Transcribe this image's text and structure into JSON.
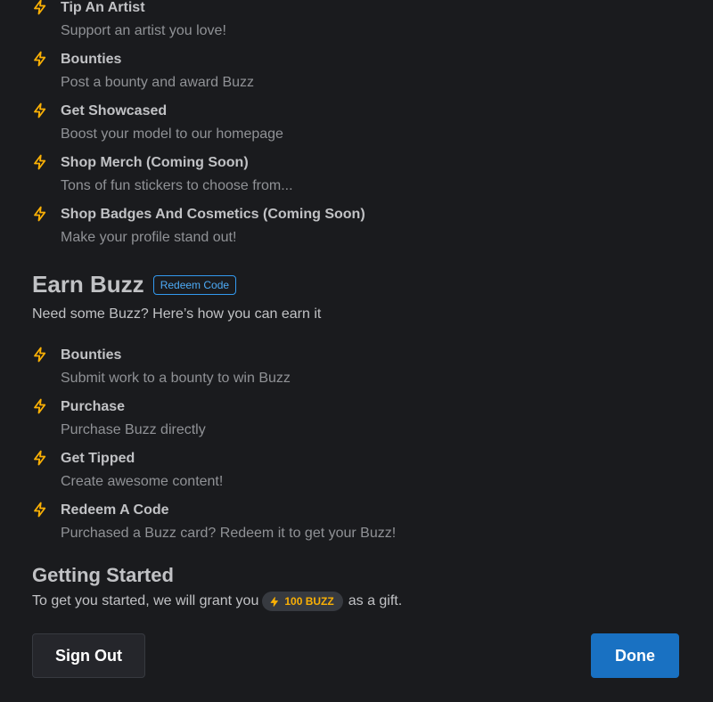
{
  "spend": {
    "items": [
      {
        "title": "Tip An Artist",
        "desc": "Support an artist you love!",
        "icon": "bolt-icon"
      },
      {
        "title": "Bounties",
        "desc": "Post a bounty and award Buzz",
        "icon": "bolt-icon"
      },
      {
        "title": "Get Showcased",
        "desc": "Boost your model to our homepage",
        "icon": "bolt-icon"
      },
      {
        "title": "Shop Merch (Coming Soon)",
        "desc": "Tons of fun stickers to choose from...",
        "icon": "bolt-icon"
      },
      {
        "title": "Shop Badges And Cosmetics (Coming Soon)",
        "desc": "Make your profile stand out!",
        "icon": "bolt-icon"
      }
    ]
  },
  "earn": {
    "title": "Earn Buzz",
    "redeem_label": "Redeem Code",
    "subtitle": "Need some Buzz? Here’s how you can earn it",
    "items": [
      {
        "title": "Bounties",
        "desc": "Submit work to a bounty to win Buzz",
        "icon": "bolt-icon"
      },
      {
        "title": "Purchase",
        "desc": "Purchase Buzz directly",
        "icon": "bolt-icon"
      },
      {
        "title": "Get Tipped",
        "desc": "Create awesome content!",
        "icon": "bolt-icon"
      },
      {
        "title": "Redeem A Code",
        "desc": "Purchased a Buzz card? Redeem it to get your Buzz!",
        "icon": "bolt-icon"
      }
    ]
  },
  "getting_started": {
    "title": "Getting Started",
    "text_before": "To get you started, we will grant you",
    "gift_amount": "100 BUZZ",
    "text_after": "as a gift."
  },
  "buttons": {
    "sign_out": "Sign Out",
    "done": "Done"
  },
  "colors": {
    "background": "#1a1b1e",
    "bolt": "#fab005",
    "primary": "#1971c2",
    "link": "#4dabf7"
  }
}
